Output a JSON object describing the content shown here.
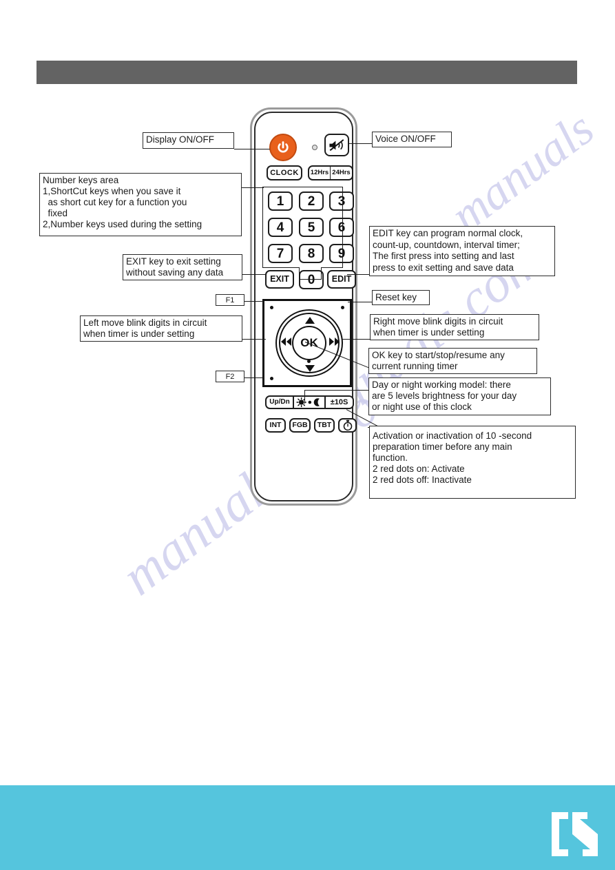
{
  "page": {
    "header_bar_color": "#636363",
    "footer_color": "#55c5dd",
    "accent_orange": "#e8601c",
    "watermark": {
      "line1": "manuals.com",
      "line2": "manualslib.com",
      "line3": "manuals"
    }
  },
  "remote": {
    "power_button": "power-icon",
    "ir_indicator": "ir-led",
    "mute_button": "mute-icon",
    "keys": {
      "clock": "CLOCK",
      "hrs12": "12Hrs",
      "hrs24": "24Hrs",
      "n1": "1",
      "n2": "2",
      "n3": "3",
      "n4": "4",
      "n5": "5",
      "n6": "6",
      "n7": "7",
      "n8": "8",
      "n9": "9",
      "n0": "0",
      "exit": "EXIT",
      "edit": "EDIT",
      "ok": "OK",
      "updn": "Up/Dn",
      "brightness": "sun-moon-icon",
      "tens": "±10S",
      "int": "INT",
      "fgb": "FGB",
      "tbt": "TBT",
      "timer": "stopwatch-icon"
    },
    "tags": {
      "f1": "F1",
      "f2": "F2"
    }
  },
  "callouts": {
    "display_onoff": {
      "line1": "Display ON/OFF"
    },
    "voice_onoff": {
      "line1": "Voice ON/OFF"
    },
    "number_keys": {
      "line1": "Number keys area",
      "line2": "1,ShortCut keys when you save it",
      "line3": "  as short cut key for a function you",
      "line4": "  fixed",
      "line5": "2,Number keys used during the setting"
    },
    "exit_key": {
      "line1": "EXIT key to exit setting",
      "line2": "without saving any data"
    },
    "edit_key": {
      "line1": "EDIT key can program normal clock,",
      "line2": "count-up, countdown, interval timer;",
      "line3": "The first press into setting and last",
      "line4": "press to exit setting and save data"
    },
    "reset_key": {
      "line1": "Reset key"
    },
    "left_move": {
      "line1": "Left move blink digits in circuit",
      "line2": "when timer is under setting"
    },
    "right_move": {
      "line1": "Right move blink digits in circuit",
      "line2": "when timer is under setting"
    },
    "ok_key": {
      "line1": "OK key to start/stop/resume any",
      "line2": "current running timer"
    },
    "day_night": {
      "line1": "Day or night working model: there",
      "line2": "are 5 levels brightness for your day",
      "line3": "or night use of this clock"
    },
    "activation": {
      "line1": "Activation or inactivation of 10 -second",
      "line2": "preparation timer before any main",
      "line3": "function.",
      "line4": "2 red dots on: Activate",
      "line5": "2 red dots off: Inactivate"
    }
  }
}
